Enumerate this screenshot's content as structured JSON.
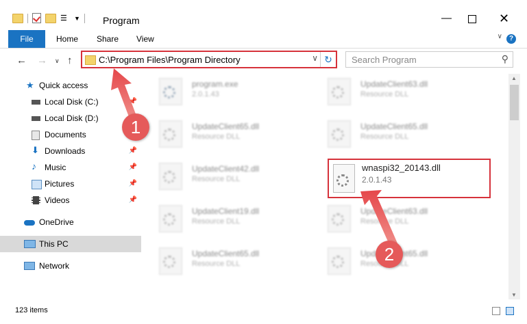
{
  "window": {
    "title": "Program"
  },
  "ribbon": {
    "tabs": [
      "File",
      "Home",
      "Share",
      "View"
    ],
    "help": "?"
  },
  "address": {
    "path": "C:\\Program Files\\Program Directory"
  },
  "search": {
    "placeholder": "Search Program"
  },
  "sidebar": {
    "items": [
      {
        "label": "Quick access",
        "icon": "star-icon",
        "pinned": false
      },
      {
        "label": "Local Disk (C:)",
        "icon": "drive-icon",
        "pinned": true
      },
      {
        "label": "Local Disk (D:)",
        "icon": "drive-icon",
        "pinned": true
      },
      {
        "label": "Documents",
        "icon": "documents-icon",
        "pinned": true
      },
      {
        "label": "Downloads",
        "icon": "download-icon",
        "pinned": true
      },
      {
        "label": "Music",
        "icon": "music-icon",
        "pinned": true
      },
      {
        "label": "Pictures",
        "icon": "pictures-icon",
        "pinned": true
      },
      {
        "label": "Videos",
        "icon": "videos-icon",
        "pinned": true
      },
      {
        "label": "OneDrive",
        "icon": "cloud-icon",
        "pinned": false
      },
      {
        "label": "This PC",
        "icon": "pc-icon",
        "pinned": false,
        "selected": true
      },
      {
        "label": "Network",
        "icon": "network-icon",
        "pinned": false
      }
    ]
  },
  "files": [
    {
      "name": "program.exe",
      "sub": "2.0.1.43"
    },
    {
      "name": "UpdateClient63.dll",
      "sub": "Resource DLL"
    },
    {
      "name": "UpdateClient65.dll",
      "sub": "Resource DLL"
    },
    {
      "name": "UpdateClient65.dll",
      "sub": "Resource DLL"
    },
    {
      "name": "UpdateClient42.dll",
      "sub": "Resource DLL"
    },
    {
      "name": "UpdateClient19.dll",
      "sub": "Resource DLL"
    },
    {
      "name": "UpdateClient63.dll",
      "sub": "Resource DLL"
    },
    {
      "name": "UpdateClient65.dll",
      "sub": "Resource DLL"
    },
    {
      "name": "UpdateClient65.dll",
      "sub": "Resource DLL"
    }
  ],
  "highlighted_file": {
    "name": "wnaspi32_20143.dll",
    "version": "2.0.1.43"
  },
  "status": {
    "items": "123 items"
  },
  "callouts": [
    "1",
    "2"
  ],
  "colors": {
    "accent": "#1a73c2",
    "highlight": "#d6313a",
    "callout": "#e55a5a"
  }
}
